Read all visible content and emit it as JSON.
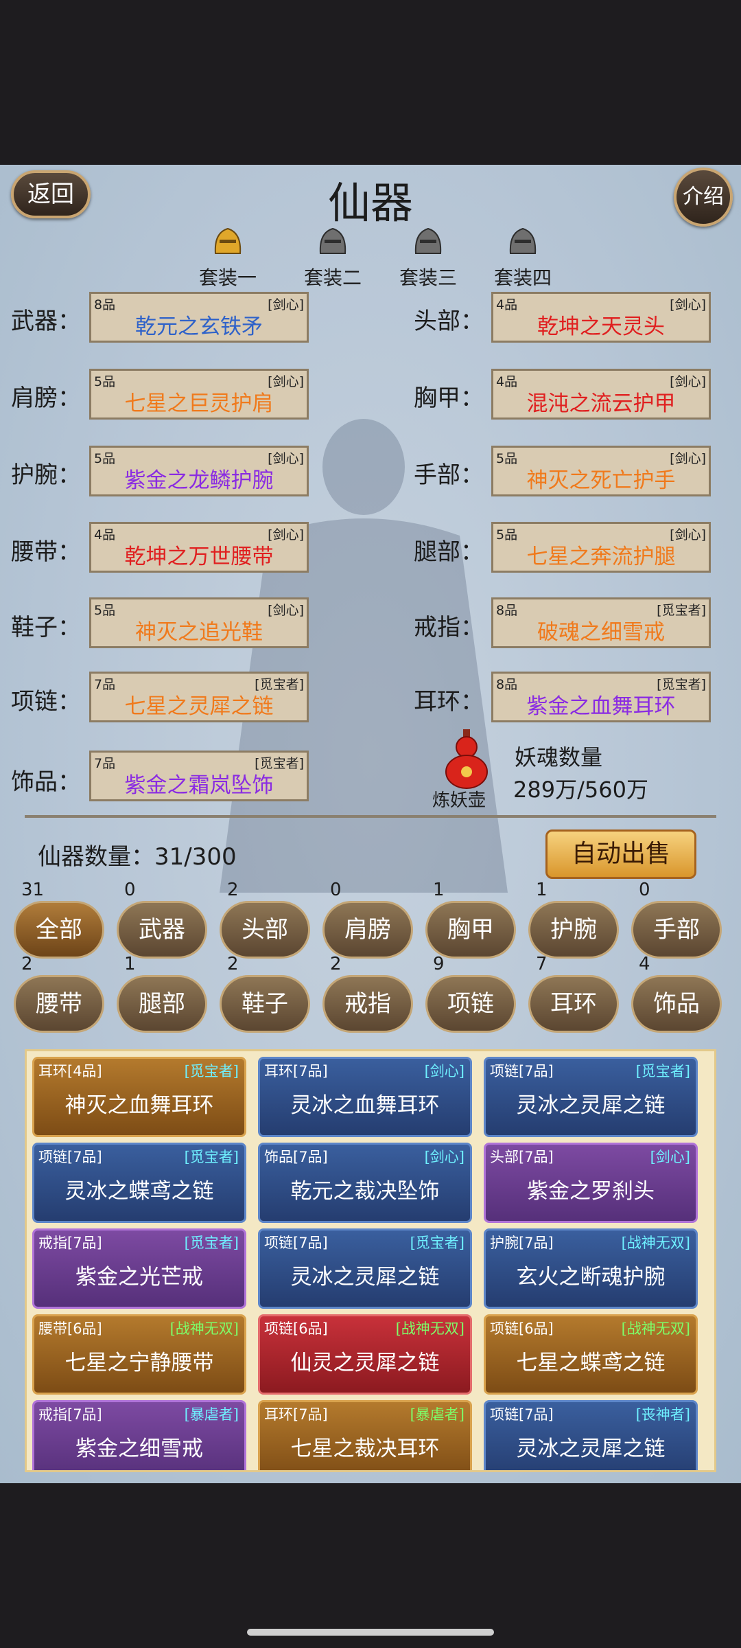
{
  "header": {
    "title": "仙器",
    "back_label": "返回",
    "intro_label": "介绍"
  },
  "suits": [
    "套装一",
    "套装二",
    "套装三",
    "套装四"
  ],
  "equipped": {
    "weapon": {
      "label": "武器：",
      "grade": "8品",
      "tag": "[剑心]",
      "name": "乾元之玄铁矛",
      "color": "#2f62c9"
    },
    "head": {
      "label": "头部：",
      "grade": "4品",
      "tag": "[剑心]",
      "name": "乾坤之天灵头",
      "color": "#e02020"
    },
    "shoulder": {
      "label": "肩膀：",
      "grade": "5品",
      "tag": "[剑心]",
      "name": "七星之巨灵护肩",
      "color": "#f07a1c"
    },
    "chest": {
      "label": "胸甲：",
      "grade": "4品",
      "tag": "[剑心]",
      "name": "混沌之流云护甲",
      "color": "#e02020"
    },
    "wrist": {
      "label": "护腕：",
      "grade": "5品",
      "tag": "[剑心]",
      "name": "紫金之龙鳞护腕",
      "color": "#8a2be2"
    },
    "hand": {
      "label": "手部：",
      "grade": "5品",
      "tag": "[剑心]",
      "name": "神灭之死亡护手",
      "color": "#f07a1c"
    },
    "belt": {
      "label": "腰带：",
      "grade": "4品",
      "tag": "[剑心]",
      "name": "乾坤之万世腰带",
      "color": "#e02020"
    },
    "leg": {
      "label": "腿部：",
      "grade": "5品",
      "tag": "[剑心]",
      "name": "七星之奔流护腿",
      "color": "#f07a1c"
    },
    "shoes": {
      "label": "鞋子：",
      "grade": "5品",
      "tag": "[剑心]",
      "name": "神灭之追光鞋",
      "color": "#f07a1c"
    },
    "ring": {
      "label": "戒指：",
      "grade": "8品",
      "tag": "[觅宝者]",
      "name": "破魂之细雪戒",
      "color": "#f07a1c"
    },
    "necklace": {
      "label": "项链：",
      "grade": "7品",
      "tag": "[觅宝者]",
      "name": "七星之灵犀之链",
      "color": "#f07a1c"
    },
    "earring": {
      "label": "耳环：",
      "grade": "8品",
      "tag": "[觅宝者]",
      "name": "紫金之血舞耳环",
      "color": "#8a2be2"
    },
    "ornament": {
      "label": "饰品：",
      "grade": "7品",
      "tag": "[觅宝者]",
      "name": "紫金之霜岚坠饰",
      "color": "#8a2be2"
    }
  },
  "refine": {
    "pot_label": "炼妖壶",
    "soul_title": "妖魂数量",
    "soul_value": "289万/560万"
  },
  "inventory": {
    "count_label": "仙器数量：31/300",
    "auto_sell": "自动出售"
  },
  "categories": [
    {
      "label": "全部",
      "count": "31"
    },
    {
      "label": "武器",
      "count": "0"
    },
    {
      "label": "头部",
      "count": "2"
    },
    {
      "label": "肩膀",
      "count": "0"
    },
    {
      "label": "胸甲",
      "count": "1"
    },
    {
      "label": "护腕",
      "count": "1"
    },
    {
      "label": "手部",
      "count": "0"
    },
    {
      "label": "腰带",
      "count": "2"
    },
    {
      "label": "腿部",
      "count": "1"
    },
    {
      "label": "鞋子",
      "count": "2"
    },
    {
      "label": "戒指",
      "count": "2"
    },
    {
      "label": "项链",
      "count": "9"
    },
    {
      "label": "耳环",
      "count": "7"
    },
    {
      "label": "饰品",
      "count": "4"
    }
  ],
  "items": [
    {
      "type": "耳环[4品]",
      "tag": "[觅宝者]",
      "name": "神灭之血舞耳环",
      "style": "gold",
      "tag_color": "#6ff0ff"
    },
    {
      "type": "耳环[7品]",
      "tag": "[剑心]",
      "name": "灵冰之血舞耳环",
      "style": "blue",
      "tag_color": "#6ff0ff"
    },
    {
      "type": "项链[7品]",
      "tag": "[觅宝者]",
      "name": "灵冰之灵犀之链",
      "style": "blue",
      "tag_color": "#6ff0ff"
    },
    {
      "type": "项链[7品]",
      "tag": "[觅宝者]",
      "name": "灵冰之蝶鸢之链",
      "style": "blue",
      "tag_color": "#6ff0ff"
    },
    {
      "type": "饰品[7品]",
      "tag": "[剑心]",
      "name": "乾元之裁决坠饰",
      "style": "blue",
      "tag_color": "#6ff0ff"
    },
    {
      "type": "头部[7品]",
      "tag": "[剑心]",
      "name": "紫金之罗刹头",
      "style": "purple",
      "tag_color": "#6ff0ff"
    },
    {
      "type": "戒指[7品]",
      "tag": "[觅宝者]",
      "name": "紫金之光芒戒",
      "style": "purple",
      "tag_color": "#6ff0ff"
    },
    {
      "type": "项链[7品]",
      "tag": "[觅宝者]",
      "name": "灵冰之灵犀之链",
      "style": "blue",
      "tag_color": "#6ff0ff"
    },
    {
      "type": "护腕[7品]",
      "tag": "[战神无双]",
      "name": "玄火之断魂护腕",
      "style": "blue",
      "tag_color": "#6ff0ff"
    },
    {
      "type": "腰带[6品]",
      "tag": "[战神无双]",
      "name": "七星之宁静腰带",
      "style": "gold",
      "tag_color": "#7dff6a"
    },
    {
      "type": "项链[6品]",
      "tag": "[战神无双]",
      "name": "仙灵之灵犀之链",
      "style": "red",
      "tag_color": "#7dff6a"
    },
    {
      "type": "项链[6品]",
      "tag": "[战神无双]",
      "name": "七星之蝶鸢之链",
      "style": "gold",
      "tag_color": "#7dff6a"
    },
    {
      "type": "戒指[7品]",
      "tag": "[暴虐者]",
      "name": "紫金之细雪戒",
      "style": "purple",
      "tag_color": "#6ff0ff"
    },
    {
      "type": "耳环[7品]",
      "tag": "[暴虐者]",
      "name": "七星之裁决耳环",
      "style": "gold",
      "tag_color": "#7dff6a"
    },
    {
      "type": "项链[7品]",
      "tag": "[丧神者]",
      "name": "灵冰之灵犀之链",
      "style": "blue",
      "tag_color": "#6ff0ff"
    }
  ]
}
